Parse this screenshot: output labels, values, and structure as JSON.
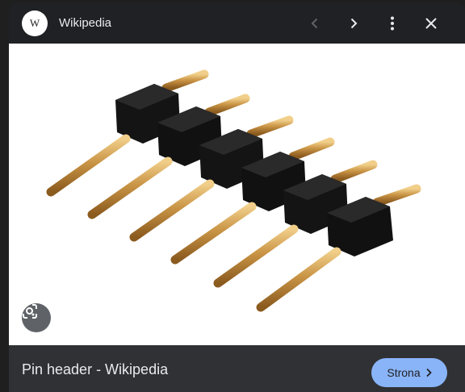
{
  "header": {
    "site_logo_letter": "W",
    "site_name": "Wikipedia",
    "prev_icon": "chevron-left-icon",
    "next_icon": "chevron-right-icon",
    "more_icon": "more-vert-icon",
    "close_icon": "close-icon"
  },
  "image": {
    "subject": "pin header",
    "lens_icon": "lens-search-icon"
  },
  "footer": {
    "title": "Pin header - Wikipedia",
    "visit_label": "Strona",
    "visit_icon": "chevron-right-icon"
  },
  "colors": {
    "header_bg": "#202124",
    "panel_bg": "#303134",
    "accent": "#8ab4f8"
  }
}
